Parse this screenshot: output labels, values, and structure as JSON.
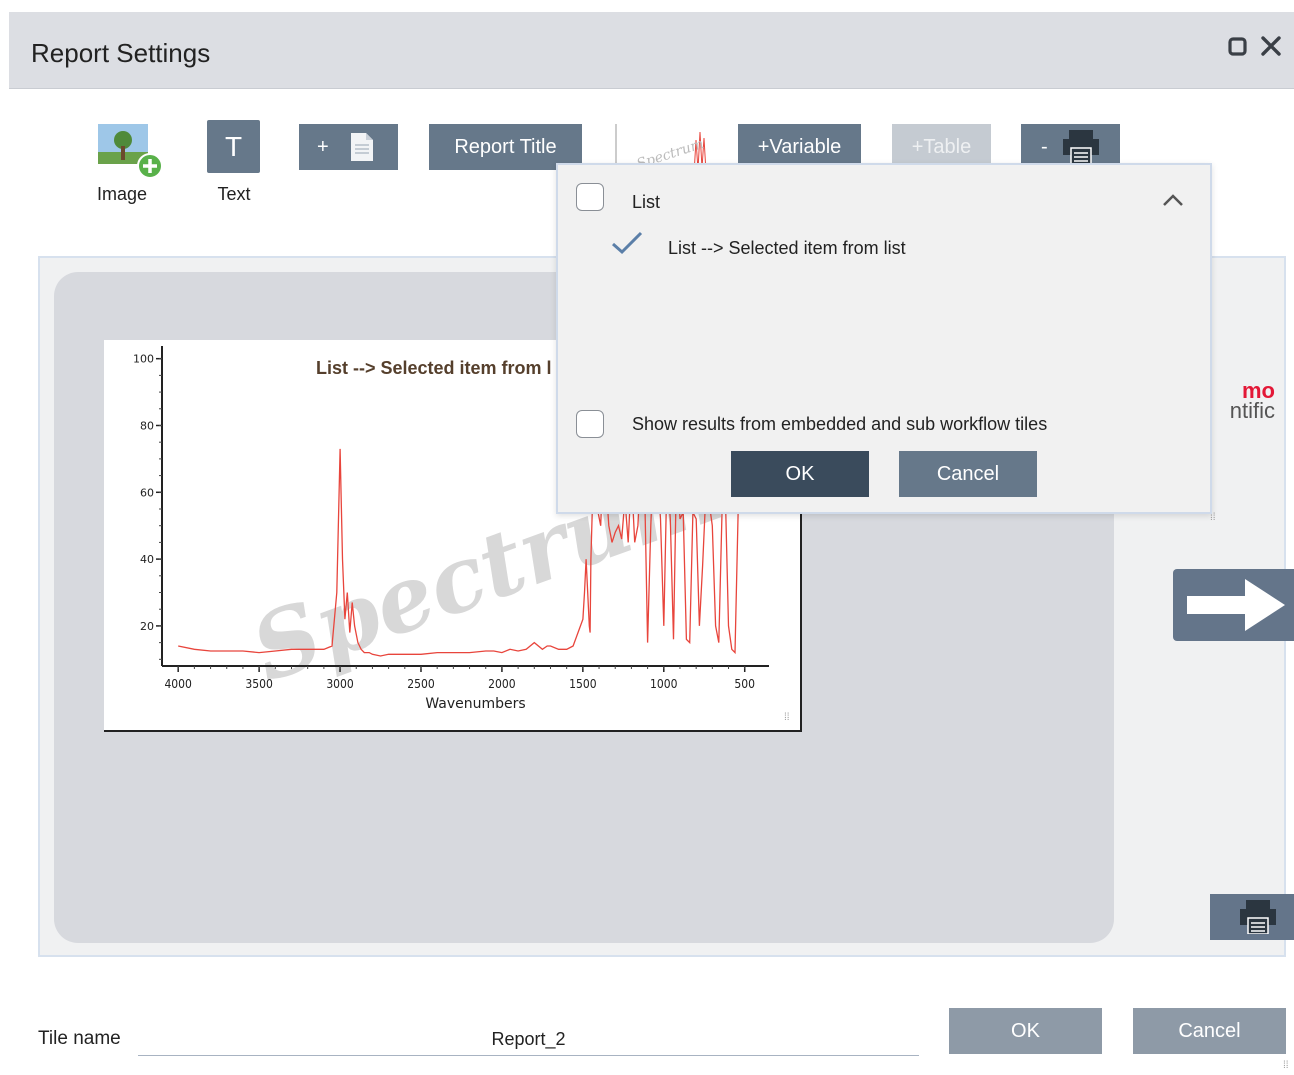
{
  "window": {
    "title": "Report Settings"
  },
  "toolbar": {
    "image_label": "Image",
    "text_glyph": "T",
    "text_label": "Text",
    "add_page_label": "+",
    "report_title_label": "Report Title",
    "thumbnail_text": "Spectrum",
    "variable_label": "+Variable",
    "table_label": "+Table",
    "remove_print_label": "-"
  },
  "preview": {
    "plot_title": "List --> Selected item from l",
    "watermark": "Spectrum",
    "xlabel": "Wavenumbers",
    "logo_line1": "mo",
    "logo_line2": "ntific"
  },
  "chart_data": {
    "type": "line",
    "title": "List --> Selected item from l",
    "xlabel": "Wavenumbers",
    "ylabel": "",
    "x_ticks": [
      4000,
      3500,
      3000,
      2500,
      2000,
      1500,
      1000,
      500
    ],
    "y_ticks": [
      20,
      40,
      60,
      80,
      100
    ],
    "xlim": [
      4100,
      350
    ],
    "ylim": [
      8,
      102
    ],
    "color": "#e8453c",
    "series": [
      {
        "x": [
          4000,
          3900,
          3800,
          3700,
          3600,
          3500,
          3400,
          3300,
          3200,
          3100,
          3050,
          3020,
          3000,
          2985,
          2970,
          2955,
          2940,
          2925,
          2910,
          2890,
          2870,
          2850,
          2820,
          2800,
          2750,
          2700,
          2600,
          2500,
          2400,
          2300,
          2200,
          2100,
          2050,
          2000,
          1950,
          1900,
          1850,
          1800,
          1750,
          1720,
          1700,
          1650,
          1600,
          1560,
          1530,
          1500,
          1490,
          1480,
          1470,
          1460,
          1455,
          1450,
          1430,
          1410,
          1390,
          1375,
          1360,
          1340,
          1320,
          1300,
          1280,
          1260,
          1240,
          1220,
          1200,
          1180,
          1160,
          1140,
          1120,
          1100,
          1080,
          1060,
          1040,
          1020,
          1000,
          980,
          960,
          940,
          920,
          900,
          880,
          860,
          840,
          820,
          800,
          780,
          760,
          740,
          720,
          700,
          680,
          660,
          640,
          620,
          600,
          580,
          560,
          540,
          520
        ],
        "y": [
          14,
          13,
          12.5,
          12.5,
          12.5,
          12,
          12.5,
          13,
          13,
          13,
          14,
          30,
          73,
          40,
          22,
          30,
          18,
          27,
          20,
          15,
          13,
          12,
          12,
          11.5,
          11,
          11.5,
          11.5,
          11.5,
          12,
          12,
          12,
          12.5,
          12.5,
          12,
          13,
          12.5,
          13,
          15,
          13,
          14,
          14,
          13,
          13,
          14,
          18,
          22,
          30,
          40,
          30,
          20,
          18,
          40,
          75,
          55,
          50,
          70,
          65,
          50,
          45,
          48,
          50,
          46,
          58,
          45,
          65,
          45,
          50,
          70,
          65,
          15,
          50,
          75,
          66,
          52,
          20,
          66,
          52,
          16,
          70,
          52,
          54,
          16,
          15,
          54,
          52,
          20,
          38,
          60,
          57,
          50,
          20,
          15,
          55,
          60,
          20,
          13,
          12,
          55,
          70
        ]
      }
    ]
  },
  "popup": {
    "list_label": "List",
    "selected_item": "List --> Selected item from list",
    "embedded_label": "Show results from embedded and sub workflow tiles",
    "ok_label": "OK",
    "cancel_label": "Cancel"
  },
  "footer": {
    "tile_name_label": "Tile name",
    "tile_name_value": "Report_2",
    "ok_label": "OK",
    "cancel_label": "Cancel"
  },
  "colors": {
    "button": "#66788a",
    "button_dark": "#3a4b5c",
    "disabled": "#c5cbd2",
    "footer_button": "#8e9aa7",
    "check_blue": "#5b7fa8"
  }
}
